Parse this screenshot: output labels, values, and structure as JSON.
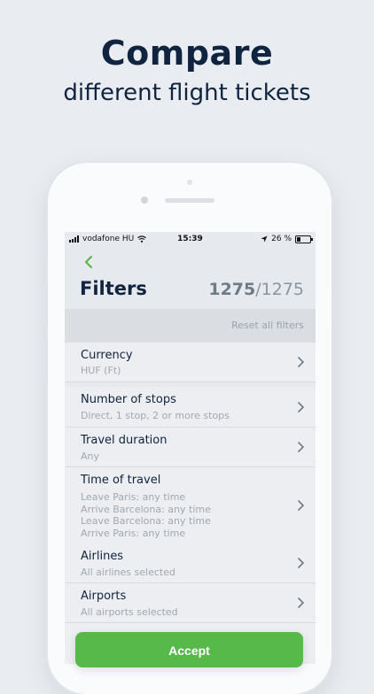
{
  "promo": {
    "headline": "Compare",
    "subline": "different flight tickets"
  },
  "status": {
    "carrier": "vodafone HU",
    "time": "15:39",
    "battery": "26 %"
  },
  "header": {
    "title": "Filters",
    "count_current": "1275",
    "count_total": "/1275",
    "reset_label": "Reset all filters"
  },
  "filters": [
    {
      "label": "Currency",
      "detail": "HUF (Ft)"
    },
    {
      "label": "Number of stops",
      "detail": "Direct, 1 stop, 2 or more stops"
    },
    {
      "label": "Travel duration",
      "detail": "Any"
    },
    {
      "label": "Time of travel",
      "detail": "Leave Paris: any time\nArrive Barcelona: any time\nLeave Barcelona: any time\nArrive Paris: any time"
    },
    {
      "label": "Airlines",
      "detail": "All airlines selected"
    },
    {
      "label": "Airports",
      "detail": "All airports selected"
    }
  ],
  "accept_label": "Accept",
  "colors": {
    "accent": "#58b94b",
    "title_text": "#10233f"
  },
  "icons": [
    "back-chevron-icon",
    "chevron-right-icon",
    "wifi-icon",
    "location-arrow-icon",
    "battery-icon",
    "signal-icon"
  ]
}
